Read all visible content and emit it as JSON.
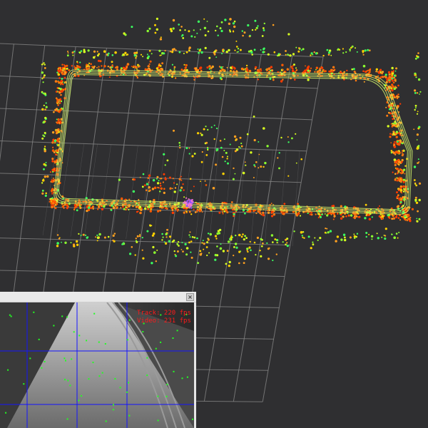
{
  "scene": {
    "background": "#2f2f31",
    "grid_color": "#8a8a8a",
    "trajectory_color": "#c8e86a",
    "point_palette": [
      "#ff3b00",
      "#ff5a00",
      "#ff7a10",
      "#ffa020",
      "#ffd000",
      "#d8ff20",
      "#8cff30",
      "#3cff60",
      "#ff2020"
    ]
  },
  "camera_window": {
    "close_glyph": "×",
    "fps_lines": [
      "Track: 220 fps",
      "Video: 231 fps"
    ],
    "overlay_line_color": "#1414ff",
    "feature_color": "#22ff22"
  }
}
